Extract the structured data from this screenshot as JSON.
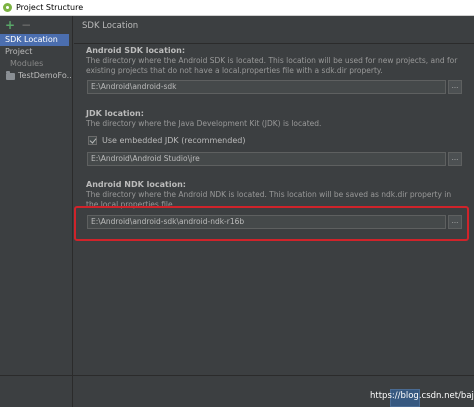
{
  "window": {
    "title": "Project Structure"
  },
  "sidebar": {
    "items": [
      {
        "label": "SDK Location",
        "selected": true
      },
      {
        "label": "Project"
      },
      {
        "label": "Modules"
      },
      {
        "label": "TestDemoFo..."
      }
    ]
  },
  "main": {
    "panel_title": "SDK Location",
    "android_sdk": {
      "title": "Android SDK location:",
      "description": "The directory where the Android SDK is located. This location will be used for new projects, and for existing projects that do not have a local.properties file with a sdk.dir property.",
      "path": "E:\\Android\\android-sdk"
    },
    "jdk": {
      "title": "JDK location:",
      "description": "The directory where the Java Development Kit (JDK) is located.",
      "checkbox_label": "Use embedded JDK (recommended)",
      "checked": true,
      "path": "E:\\Android\\Android Studio\\jre"
    },
    "ndk": {
      "title": "Android NDK location:",
      "description": "The directory where the Android NDK is located. This location will be saved as ndk.dir property in the local.properties file.",
      "path": "E:\\Android\\android-sdk\\android-ndk-r16b"
    },
    "browse_label": "..."
  },
  "footer": {
    "watermark": "https://blog.csdn.net/bajeyo"
  },
  "colors": {
    "highlight": "#d0232a",
    "selection": "#4b6eaf",
    "background": "#3c3f41"
  }
}
